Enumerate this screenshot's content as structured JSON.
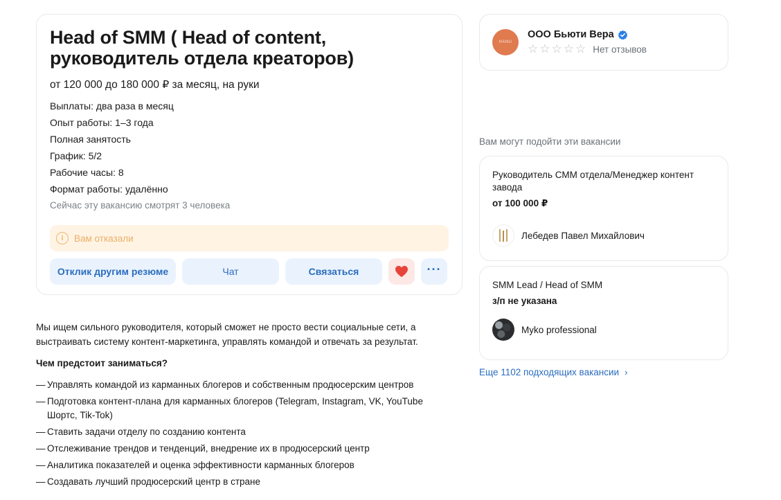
{
  "vacancy": {
    "title": "Head of SMM ( Head of content, руководитель отдела креаторов)",
    "salary": "от 120 000 до 180 000 ₽ за месяц, на руки",
    "facts": [
      "Выплаты: два раза в месяц",
      "Опыт работы: 1–3 года",
      "Полная занятость",
      "График: 5/2",
      "Рабочие часы: 8",
      "Формат работы: удалённо"
    ],
    "viewers": "Сейчас эту вакансию смотрят 3 человека",
    "rejected_text": "Вам отказали",
    "buttons": {
      "resume": "Отклик другим резюме",
      "chat": "Чат",
      "contact": "Связаться",
      "heart_icon": "heart-icon",
      "more_icon": "more-dots-icon"
    }
  },
  "description": {
    "intro": "Мы ищем сильного руководителя, который сможет не просто вести социальные сети, а выстраивать систему контент-маркетинга, управлять командой и отвечать за результат.",
    "heading": "Чем предстоит заниматься?",
    "duties": [
      "Управлять командой из карманных блогеров и собственным продюсерским центров",
      "Подготовка контент-плана для карманных блогеров (Telegram, Instagram, VK, YouTube Шортс, Tik-Tok)",
      "Ставить задачи отделу по созданию контента",
      "Отслеживание трендов и тенденций, внедрение их в продюсерский центр",
      "Аналитика показателей и оценка эффективности карманных блогеров",
      "Создавать лучший продюсерский центр в стране"
    ],
    "dash": "—"
  },
  "employer": {
    "name": "ООО Бьюти Вера",
    "logo_text": "HANU",
    "reviews": "Нет отзывов",
    "star": "☆"
  },
  "suggestions": {
    "title": "Вам могут подойти эти вакансии",
    "items": [
      {
        "title": "Руководитель СММ отдела/Менеджер контент завода",
        "salary": "от 100 000 ₽",
        "company": "Лебедев Павел Михайлович"
      },
      {
        "title": "SMM Lead / Head of SMM",
        "salary": "з/п не указана",
        "company": "Myko professional"
      }
    ],
    "more_link": "Еще 1102 подходящих вакансии",
    "chevron": "›"
  },
  "colors": {
    "accent": "#2b6cbf",
    "button_bg": "#eaf3fd",
    "warning_bg": "#fff3e4",
    "warning_text": "#e9b067",
    "heart": "#e8433a",
    "verified": "#2b7ee6"
  }
}
